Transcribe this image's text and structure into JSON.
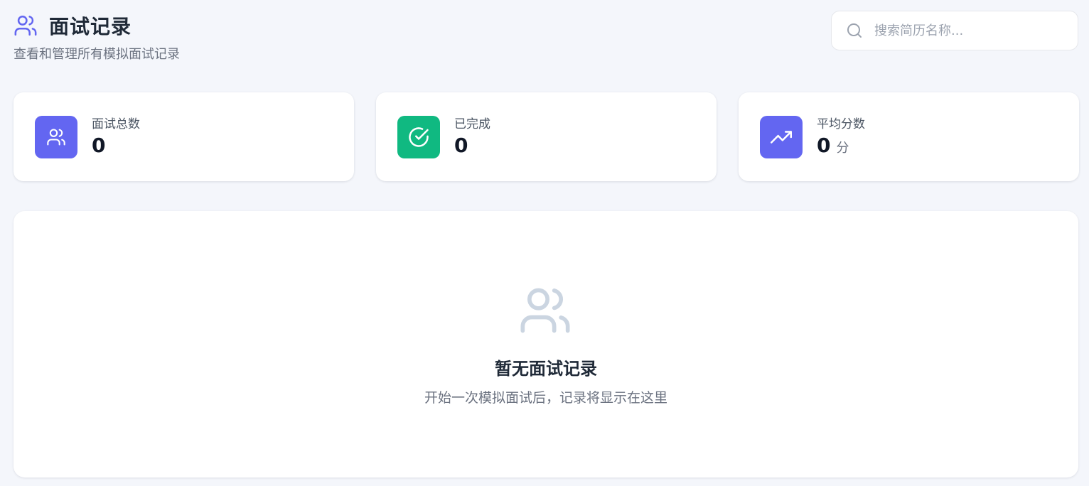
{
  "header": {
    "title": "面试记录",
    "subtitle": "查看和管理所有模拟面试记录",
    "icon": "users-icon"
  },
  "search": {
    "placeholder": "搜索简历名称...",
    "value": "",
    "icon": "search-icon"
  },
  "stats": [
    {
      "label": "面试总数",
      "value": "0",
      "unit": "",
      "icon": "users-icon",
      "color": "#6366f1"
    },
    {
      "label": "已完成",
      "value": "0",
      "unit": "",
      "icon": "check-circle-icon",
      "color": "#10b981"
    },
    {
      "label": "平均分数",
      "value": "0",
      "unit": "分",
      "icon": "trending-up-icon",
      "color": "#6366f1"
    }
  ],
  "empty_state": {
    "title": "暂无面试记录",
    "description": "开始一次模拟面试后，记录将显示在这里",
    "icon": "users-icon"
  },
  "colors": {
    "accent": "#6366f1",
    "success": "#10b981",
    "background": "#f4f6fb",
    "muted_icon": "#cbd5e1"
  }
}
